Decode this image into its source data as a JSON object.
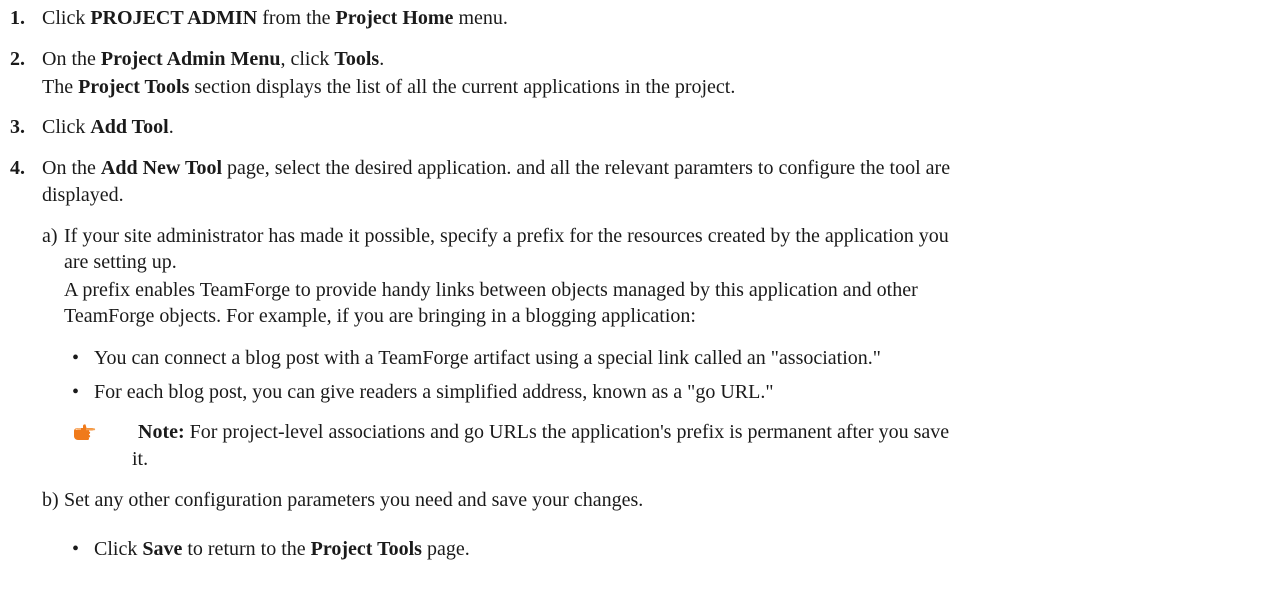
{
  "steps": [
    {
      "num": "1.",
      "parts": [
        "Click ",
        "PROJECT ADMIN",
        " from the ",
        "Project Home",
        " menu."
      ]
    },
    {
      "num": "2.",
      "parts": [
        "On the ",
        "Project Admin Menu",
        ", click ",
        "Tools",
        "."
      ],
      "result_parts": [
        "The ",
        "Project Tools",
        " section displays the list of all the current applications in the project."
      ]
    },
    {
      "num": "3.",
      "parts": [
        "Click ",
        "Add Tool",
        "."
      ]
    },
    {
      "num": "4.",
      "parts": [
        "On the ",
        "Add New Tool",
        " page, select the desired application. and all the relevant paramters to configure the tool are"
      ],
      "line2": "displayed."
    }
  ],
  "substeps": {
    "a": {
      "label": "a)",
      "line1": "If your site administrator has made it possible, specify a prefix for the resources created by the application you",
      "line2": "are setting up.",
      "line3": "A prefix enables TeamForge to provide handy links between objects managed by this application and other",
      "line4": "TeamForge objects. For example, if you are bringing in a blogging application:",
      "bullets": [
        "You can connect a blog post with a TeamForge artifact using a special link called an \"association.\"",
        "For each blog post, you can give readers a simplified address, known as a \"go URL.\""
      ],
      "note": {
        "icon": "pointing-hand-icon",
        "label": "Note:",
        "line1": " For project-level associations and go URLs the application's prefix is permanent after you save",
        "line2": "it."
      }
    },
    "b": {
      "label": "b)",
      "line1": "Set any other configuration parameters you need and save your changes.",
      "bullet_parts": [
        "Click ",
        "Save",
        " to return to the ",
        "Project Tools",
        " page."
      ]
    }
  },
  "colors": {
    "text": "#1a1a1a",
    "hand_icon": "#f07a1a"
  }
}
